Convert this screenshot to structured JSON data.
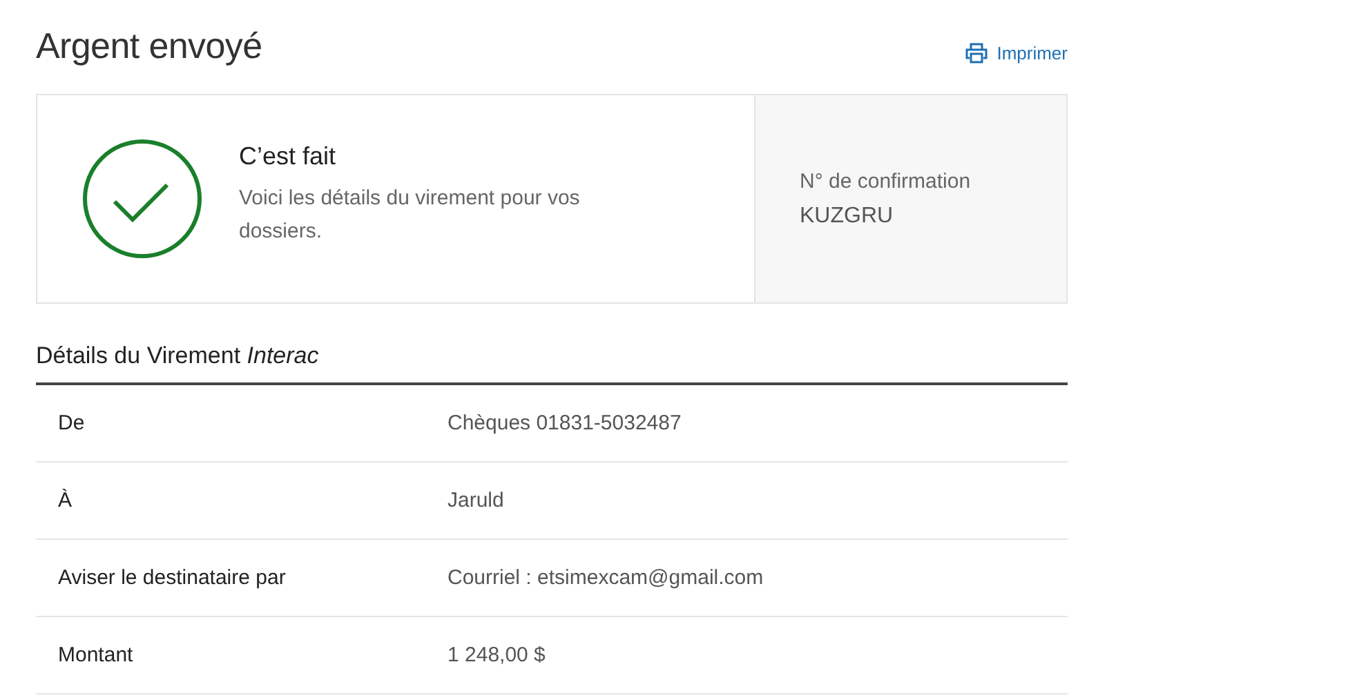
{
  "page_title": "Argent envoyé",
  "print_link": {
    "label": "Imprimer"
  },
  "status_card": {
    "kind": "success",
    "title": "C’est fait",
    "message": "Voici les détails du virement pour vos dossiers.",
    "confirmation_label": "N° de confirmation",
    "confirmation_number": "KUZGRU"
  },
  "details": {
    "heading": "Détails du Virement *Interac*",
    "rows": [
      {
        "label": "De",
        "value": "Chèques 01831-5032487"
      },
      {
        "label": "À",
        "value": "Jaruld"
      },
      {
        "label": "Aviser le destinataire par",
        "value": "Courriel : etsimexcam@gmail.com"
      },
      {
        "label": "Montant",
        "value": "1 248,00 $"
      }
    ]
  }
}
